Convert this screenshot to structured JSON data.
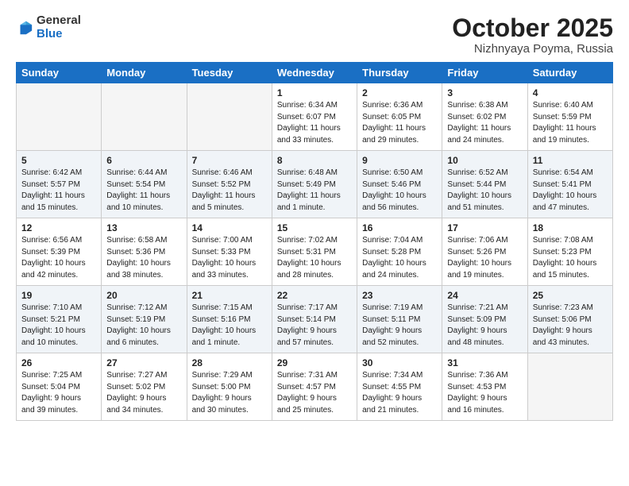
{
  "header": {
    "logo_general": "General",
    "logo_blue": "Blue",
    "month": "October 2025",
    "location": "Nizhnyaya Poyma, Russia"
  },
  "weekdays": [
    "Sunday",
    "Monday",
    "Tuesday",
    "Wednesday",
    "Thursday",
    "Friday",
    "Saturday"
  ],
  "weeks": [
    [
      {
        "day": "",
        "info": ""
      },
      {
        "day": "",
        "info": ""
      },
      {
        "day": "",
        "info": ""
      },
      {
        "day": "1",
        "info": "Sunrise: 6:34 AM\nSunset: 6:07 PM\nDaylight: 11 hours\nand 33 minutes."
      },
      {
        "day": "2",
        "info": "Sunrise: 6:36 AM\nSunset: 6:05 PM\nDaylight: 11 hours\nand 29 minutes."
      },
      {
        "day": "3",
        "info": "Sunrise: 6:38 AM\nSunset: 6:02 PM\nDaylight: 11 hours\nand 24 minutes."
      },
      {
        "day": "4",
        "info": "Sunrise: 6:40 AM\nSunset: 5:59 PM\nDaylight: 11 hours\nand 19 minutes."
      }
    ],
    [
      {
        "day": "5",
        "info": "Sunrise: 6:42 AM\nSunset: 5:57 PM\nDaylight: 11 hours\nand 15 minutes."
      },
      {
        "day": "6",
        "info": "Sunrise: 6:44 AM\nSunset: 5:54 PM\nDaylight: 11 hours\nand 10 minutes."
      },
      {
        "day": "7",
        "info": "Sunrise: 6:46 AM\nSunset: 5:52 PM\nDaylight: 11 hours\nand 5 minutes."
      },
      {
        "day": "8",
        "info": "Sunrise: 6:48 AM\nSunset: 5:49 PM\nDaylight: 11 hours\nand 1 minute."
      },
      {
        "day": "9",
        "info": "Sunrise: 6:50 AM\nSunset: 5:46 PM\nDaylight: 10 hours\nand 56 minutes."
      },
      {
        "day": "10",
        "info": "Sunrise: 6:52 AM\nSunset: 5:44 PM\nDaylight: 10 hours\nand 51 minutes."
      },
      {
        "day": "11",
        "info": "Sunrise: 6:54 AM\nSunset: 5:41 PM\nDaylight: 10 hours\nand 47 minutes."
      }
    ],
    [
      {
        "day": "12",
        "info": "Sunrise: 6:56 AM\nSunset: 5:39 PM\nDaylight: 10 hours\nand 42 minutes."
      },
      {
        "day": "13",
        "info": "Sunrise: 6:58 AM\nSunset: 5:36 PM\nDaylight: 10 hours\nand 38 minutes."
      },
      {
        "day": "14",
        "info": "Sunrise: 7:00 AM\nSunset: 5:33 PM\nDaylight: 10 hours\nand 33 minutes."
      },
      {
        "day": "15",
        "info": "Sunrise: 7:02 AM\nSunset: 5:31 PM\nDaylight: 10 hours\nand 28 minutes."
      },
      {
        "day": "16",
        "info": "Sunrise: 7:04 AM\nSunset: 5:28 PM\nDaylight: 10 hours\nand 24 minutes."
      },
      {
        "day": "17",
        "info": "Sunrise: 7:06 AM\nSunset: 5:26 PM\nDaylight: 10 hours\nand 19 minutes."
      },
      {
        "day": "18",
        "info": "Sunrise: 7:08 AM\nSunset: 5:23 PM\nDaylight: 10 hours\nand 15 minutes."
      }
    ],
    [
      {
        "day": "19",
        "info": "Sunrise: 7:10 AM\nSunset: 5:21 PM\nDaylight: 10 hours\nand 10 minutes."
      },
      {
        "day": "20",
        "info": "Sunrise: 7:12 AM\nSunset: 5:19 PM\nDaylight: 10 hours\nand 6 minutes."
      },
      {
        "day": "21",
        "info": "Sunrise: 7:15 AM\nSunset: 5:16 PM\nDaylight: 10 hours\nand 1 minute."
      },
      {
        "day": "22",
        "info": "Sunrise: 7:17 AM\nSunset: 5:14 PM\nDaylight: 9 hours\nand 57 minutes."
      },
      {
        "day": "23",
        "info": "Sunrise: 7:19 AM\nSunset: 5:11 PM\nDaylight: 9 hours\nand 52 minutes."
      },
      {
        "day": "24",
        "info": "Sunrise: 7:21 AM\nSunset: 5:09 PM\nDaylight: 9 hours\nand 48 minutes."
      },
      {
        "day": "25",
        "info": "Sunrise: 7:23 AM\nSunset: 5:06 PM\nDaylight: 9 hours\nand 43 minutes."
      }
    ],
    [
      {
        "day": "26",
        "info": "Sunrise: 7:25 AM\nSunset: 5:04 PM\nDaylight: 9 hours\nand 39 minutes."
      },
      {
        "day": "27",
        "info": "Sunrise: 7:27 AM\nSunset: 5:02 PM\nDaylight: 9 hours\nand 34 minutes."
      },
      {
        "day": "28",
        "info": "Sunrise: 7:29 AM\nSunset: 5:00 PM\nDaylight: 9 hours\nand 30 minutes."
      },
      {
        "day": "29",
        "info": "Sunrise: 7:31 AM\nSunset: 4:57 PM\nDaylight: 9 hours\nand 25 minutes."
      },
      {
        "day": "30",
        "info": "Sunrise: 7:34 AM\nSunset: 4:55 PM\nDaylight: 9 hours\nand 21 minutes."
      },
      {
        "day": "31",
        "info": "Sunrise: 7:36 AM\nSunset: 4:53 PM\nDaylight: 9 hours\nand 16 minutes."
      },
      {
        "day": "",
        "info": ""
      }
    ]
  ]
}
